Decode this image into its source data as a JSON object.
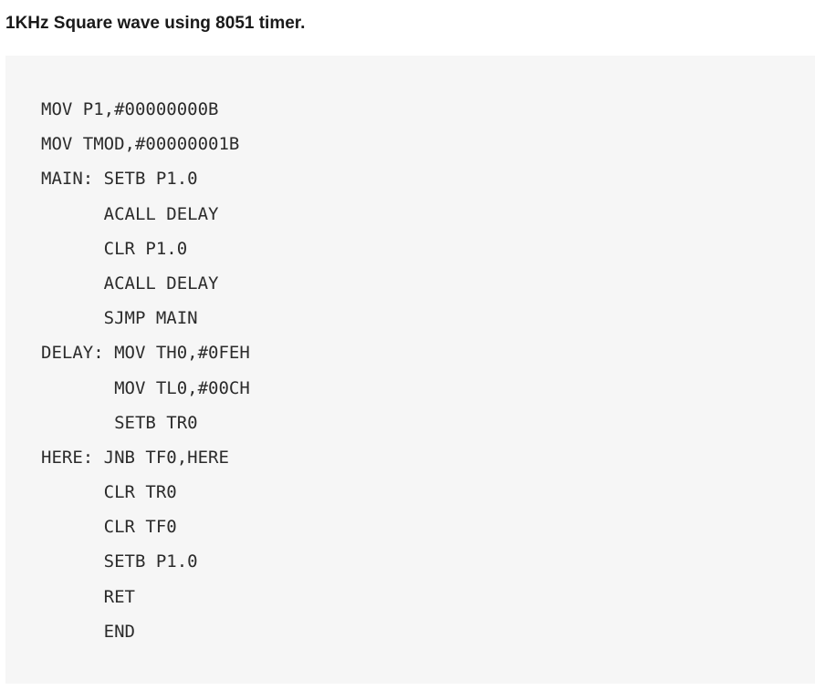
{
  "document": {
    "title": "1KHz Square wave using 8051 timer."
  },
  "code": {
    "lines": [
      "MOV P1,#00000000B",
      "MOV TMOD,#00000001B",
      "MAIN: SETB P1.0",
      "      ACALL DELAY",
      "      CLR P1.0",
      "      ACALL DELAY",
      "      SJMP MAIN",
      "DELAY: MOV TH0,#0FEH",
      "       MOV TL0,#00CH",
      "       SETB TR0",
      "HERE: JNB TF0,HERE",
      "      CLR TR0",
      "      CLR TF0",
      "      SETB P1.0",
      "      RET",
      "      END"
    ]
  }
}
